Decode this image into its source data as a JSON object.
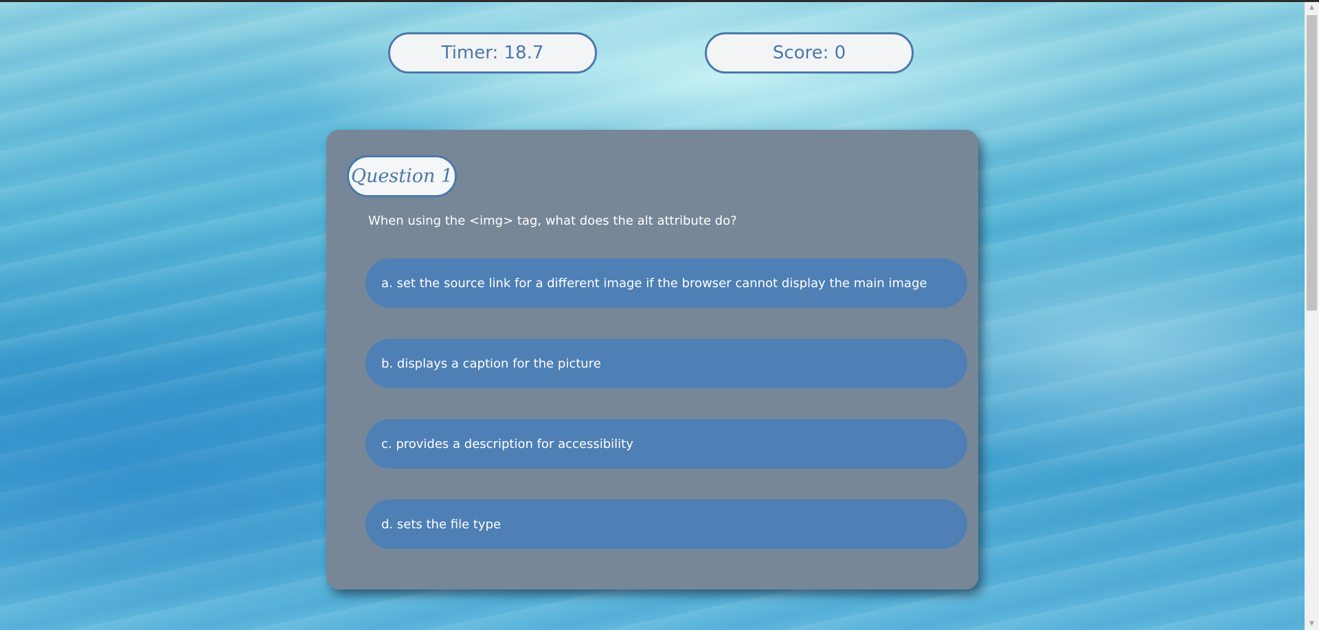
{
  "hud": {
    "timer_text": "Timer: 18.7",
    "score_text": "Score: 0"
  },
  "quiz": {
    "question_label": "Question 1",
    "question_text": "When using the <img> tag, what does the alt attribute do?",
    "answers": [
      "a. set the source link for a different image if the browser cannot display the main image",
      "b. displays a caption for the picture",
      "c. provides a description for accessibility",
      "d. sets the file type"
    ]
  },
  "scrollbar": {
    "up_icon": "scroll-up-arrow",
    "down_icon": "scroll-down-arrow",
    "up_glyph": "▲",
    "down_glyph": "▼"
  },
  "colors": {
    "accent": "#4a78aa",
    "card": "#778798",
    "answer_button": "#4e7fb5"
  }
}
